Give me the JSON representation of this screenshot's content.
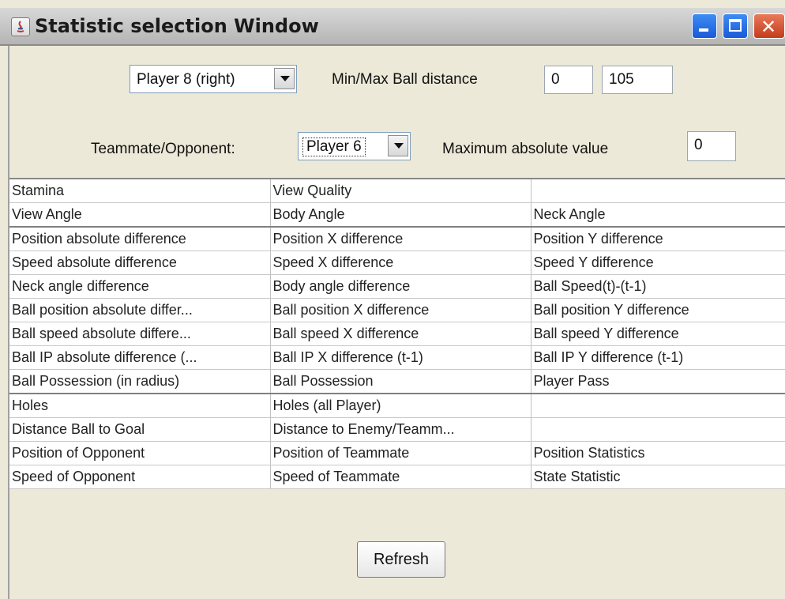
{
  "window": {
    "title": "Statistic selection Window"
  },
  "controls": {
    "player_select": "Player 8 (right)",
    "ball_distance_label": "Min/Max Ball distance",
    "min_ball_distance": "0",
    "max_ball_distance": "105",
    "teammate_label": "Teammate/Opponent:",
    "teammate_select": "Player 6",
    "max_abs_label": "Maximum absolute value",
    "max_abs_value": "0"
  },
  "grid": {
    "rows": [
      [
        "Stamina",
        "View Quality",
        ""
      ],
      [
        "View Angle",
        "Body Angle",
        "Neck Angle"
      ],
      [
        "Position absolute difference",
        "Position X difference",
        "Position Y difference"
      ],
      [
        "Speed absolute difference",
        "Speed X difference",
        "Speed Y difference"
      ],
      [
        "Neck angle difference",
        "Body angle difference",
        "Ball Speed(t)-(t-1)"
      ],
      [
        "Ball position absolute differ...",
        "Ball position X difference",
        "Ball position Y difference"
      ],
      [
        "Ball speed absolute differe...",
        "Ball speed X difference",
        "Ball speed Y difference"
      ],
      [
        "Ball IP absolute difference (...",
        "Ball IP X difference (t-1)",
        "Ball IP Y difference (t-1)"
      ],
      [
        "Ball Possession (in radius)",
        "Ball Possession",
        "Player Pass"
      ],
      [
        "Holes",
        "Holes (all Player)",
        ""
      ],
      [
        "Distance Ball to Goal",
        "Distance to Enemy/Teamm...",
        ""
      ],
      [
        "Position of Opponent",
        "Position of Teammate",
        "Position Statistics"
      ],
      [
        "Speed of Opponent",
        "Speed of Teammate",
        "State Statistic"
      ]
    ]
  },
  "buttons": {
    "refresh": "Refresh"
  },
  "icons": {
    "app": "java-icon",
    "minimize": "minimize-icon",
    "maximize": "maximize-icon",
    "close": "close-icon"
  }
}
